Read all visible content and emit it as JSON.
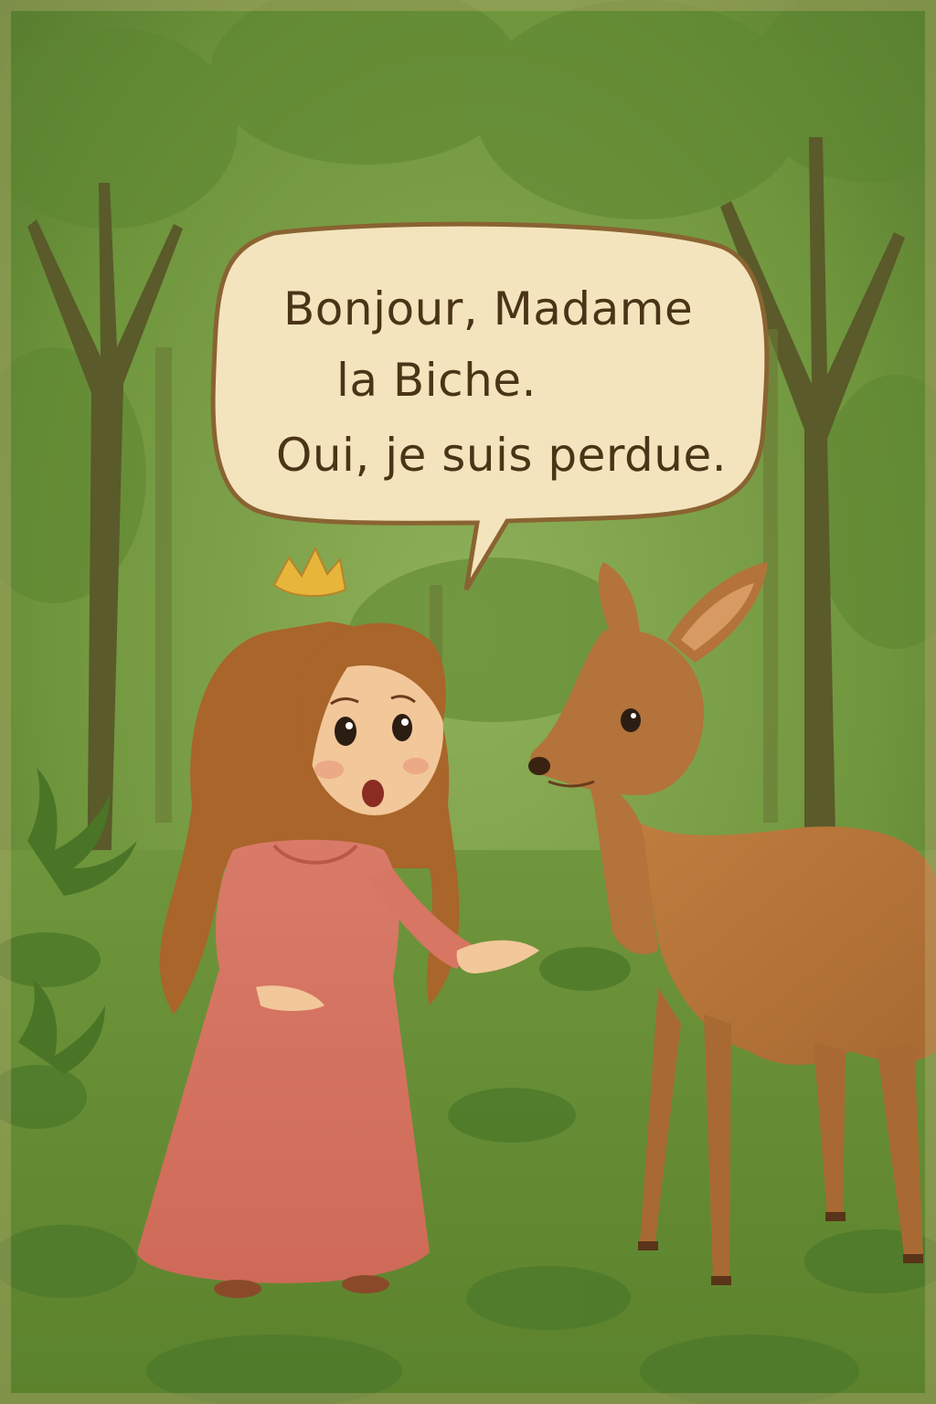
{
  "speech_bubble": {
    "line1": "Bonjour, Madame",
    "line2": "la Biche.",
    "line3": "Oui, je suis perdue."
  },
  "colors": {
    "forest_light": "#8aa64e",
    "forest_dark": "#4f7a2c",
    "bubble_fill": "#f3e4bd",
    "bubble_stroke": "#8a6332",
    "text": "#4a3417",
    "dress": "#d67663",
    "hair": "#a9652a",
    "crown": "#e7b53a",
    "deer": "#b3733a"
  },
  "icons": [
    "crown-icon"
  ]
}
